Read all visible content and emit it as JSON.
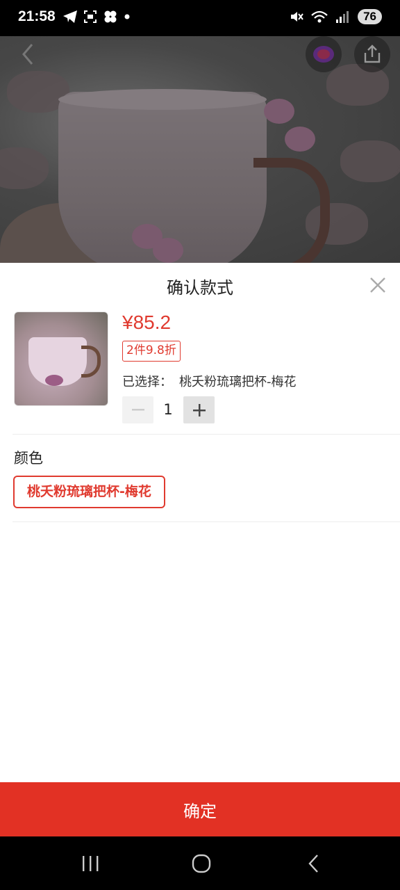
{
  "status_bar": {
    "time": "21:58",
    "battery": "76",
    "left_icons": [
      "telegram-icon",
      "screenshot-icon",
      "app-icon",
      "dot-icon"
    ],
    "right_icons": [
      "mute-icon",
      "wifi-icon",
      "signal-icon"
    ]
  },
  "top_nav": {
    "icons": [
      "back-icon",
      "app-logo-icon",
      "share-icon"
    ]
  },
  "sheet": {
    "title": "确认款式",
    "price": "¥85.2",
    "discount": "2件9.8折",
    "selected_label": "已选择：",
    "selected_value": "桃夭粉琉璃把杯-梅花",
    "quantity": "1",
    "section_title": "颜色",
    "option_selected": "桃夭粉琉璃把杯-梅花",
    "confirm_label": "确定"
  },
  "colors": {
    "accent": "#e23124",
    "price": "#e03a2f"
  },
  "nav_bar": {
    "icons": [
      "recent-apps-icon",
      "home-icon",
      "back-icon"
    ]
  }
}
